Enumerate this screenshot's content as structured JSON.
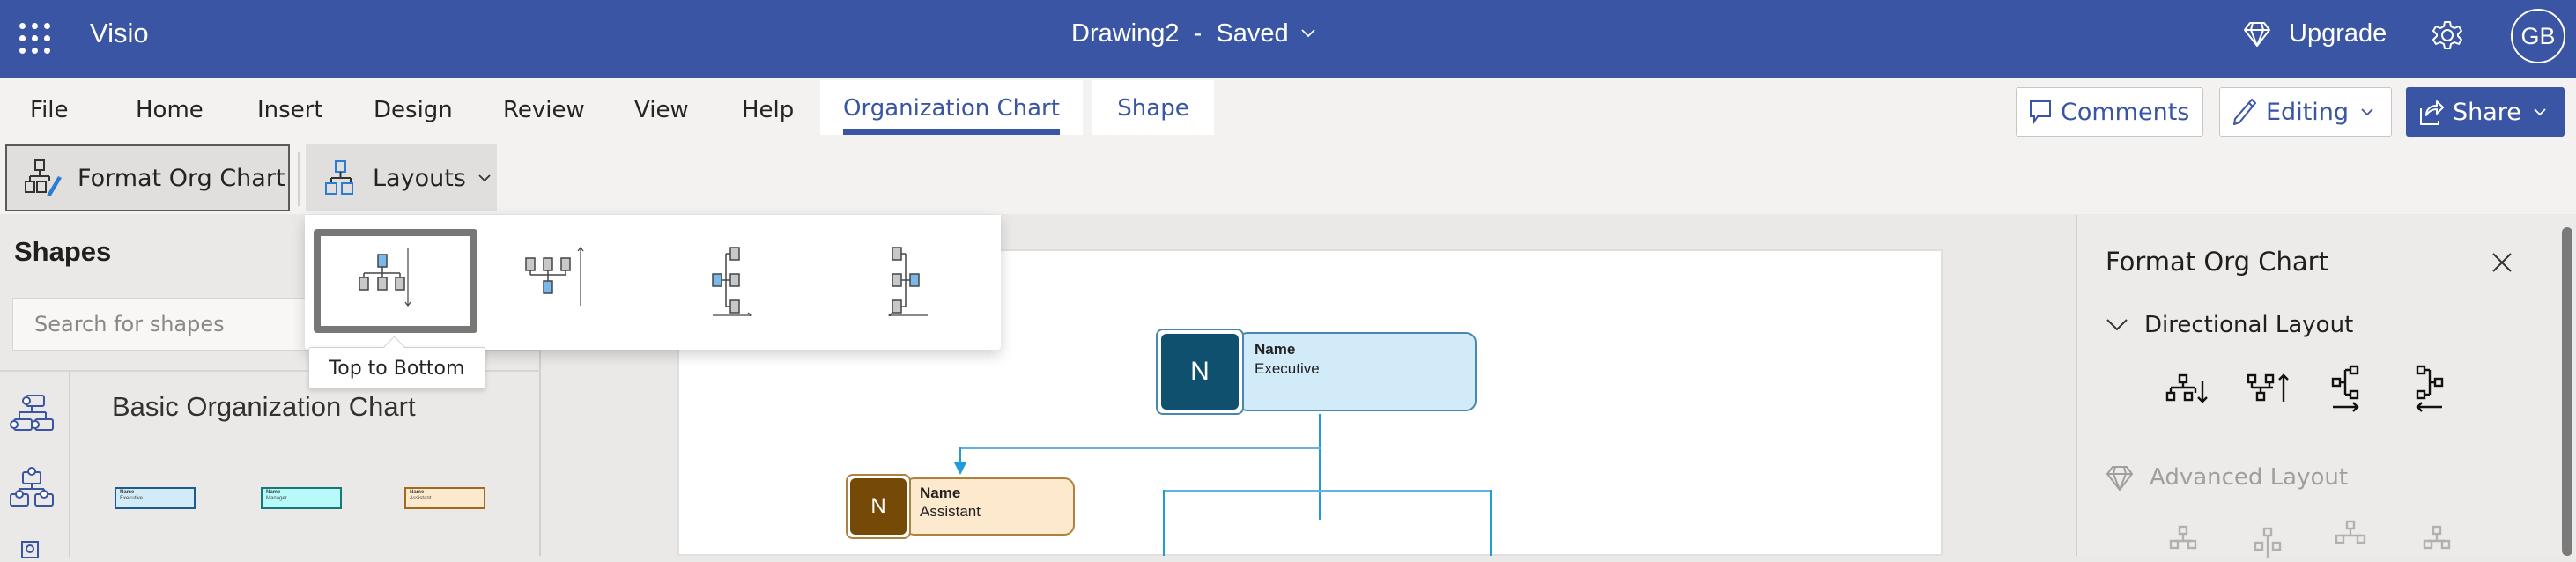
{
  "titlebar": {
    "app_name": "Visio",
    "doc_title": "Drawing2  -  Saved",
    "upgrade_label": "Upgrade",
    "avatar_initials": "GB",
    "brand_color": "#3955a3"
  },
  "tabs": [
    {
      "label": "File"
    },
    {
      "label": "Home"
    },
    {
      "label": "Insert"
    },
    {
      "label": "Design"
    },
    {
      "label": "Review"
    },
    {
      "label": "View"
    },
    {
      "label": "Help"
    },
    {
      "label": "Organization Chart",
      "active": true,
      "contextual": true
    },
    {
      "label": "Shape",
      "contextual": true
    }
  ],
  "header_actions": {
    "comments_label": "Comments",
    "editing_label": "Editing",
    "share_label": "Share"
  },
  "ribbon": {
    "format_org_chart_label": "Format Org Chart",
    "layouts_label": "Layouts"
  },
  "layouts_dropdown": {
    "options": [
      {
        "name": "Top to Bottom",
        "selected": true
      },
      {
        "name": "Bottom to Top"
      },
      {
        "name": "Left to Right"
      },
      {
        "name": "Right to Left"
      }
    ],
    "tooltip": "Top to Bottom"
  },
  "shapes_panel": {
    "title": "Shapes",
    "search_placeholder": "Search for shapes",
    "stencil_name": "Basic Organization Chart",
    "stencil_shapes": [
      {
        "name": "Name",
        "role": "Executive",
        "fill": "#d2ebf9",
        "border": "#1c5c8a"
      },
      {
        "name": "Name",
        "role": "Manager",
        "fill": "#b8fafa",
        "border": "#17787a"
      },
      {
        "name": "Name",
        "role": "Assistant",
        "fill": "#fde9cd",
        "border": "#a46a1c"
      }
    ]
  },
  "canvas": {
    "nodes": [
      {
        "initial": "N",
        "name": "Name",
        "role": "Executive",
        "photo_color": "#10506f",
        "fill": "#d2ebf9",
        "border": "#4a87ae"
      },
      {
        "initial": "N",
        "name": "Name",
        "role": "Assistant",
        "photo_color": "#744a06",
        "fill": "#fde9cd",
        "border": "#b0803f"
      }
    ],
    "connector_color": "#1f9bd7"
  },
  "format_panel": {
    "title": "Format Org Chart",
    "directional_section": "Directional Layout",
    "directional_options": [
      "Top to Bottom",
      "Bottom to Top",
      "Left to Right",
      "Right to Left"
    ],
    "advanced_section": "Advanced Layout"
  }
}
